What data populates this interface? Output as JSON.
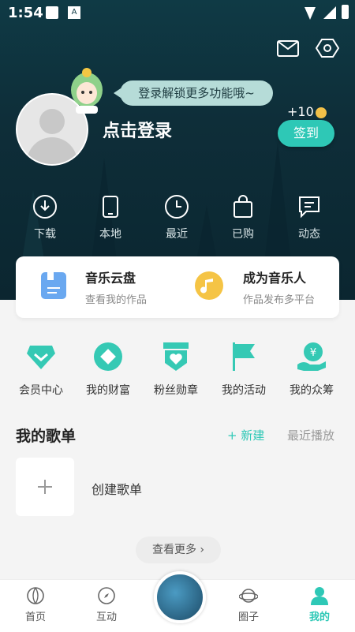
{
  "status": {
    "time": "1:54"
  },
  "header": {
    "bubble_text": "登录解锁更多功能哦~",
    "login_text": "点击登录",
    "coin_text": "+10",
    "signin_label": "签到"
  },
  "quick_actions": [
    {
      "label": "下载",
      "icon": "download-icon"
    },
    {
      "label": "本地",
      "icon": "phone-icon"
    },
    {
      "label": "最近",
      "icon": "clock-icon"
    },
    {
      "label": "已购",
      "icon": "bag-icon"
    },
    {
      "label": "动态",
      "icon": "message-icon"
    }
  ],
  "card": {
    "left": {
      "title": "音乐云盘",
      "subtitle": "查看我的作品"
    },
    "right": {
      "title": "成为音乐人",
      "subtitle": "作品发布多平台"
    }
  },
  "features": [
    {
      "label": "会员中心",
      "icon": "diamond-icon"
    },
    {
      "label": "我的财富",
      "icon": "wealth-icon"
    },
    {
      "label": "粉丝勋章",
      "icon": "medal-icon"
    },
    {
      "label": "我的活动",
      "icon": "flag-icon"
    },
    {
      "label": "我的众筹",
      "icon": "crowdfund-icon"
    }
  ],
  "playlist": {
    "title": "我的歌单",
    "new_label": "+ 新建",
    "recent_label": "最近播放",
    "create_label": "创建歌单",
    "more_label": "查看更多 ›"
  },
  "tabbar": [
    {
      "label": "首页",
      "active": false
    },
    {
      "label": "互动",
      "active": false
    },
    {
      "label": "圈子",
      "active": false
    },
    {
      "label": "我的",
      "active": true
    }
  ],
  "colors": {
    "accent": "#2ec8b6",
    "header_bg": "#0f3a45"
  }
}
